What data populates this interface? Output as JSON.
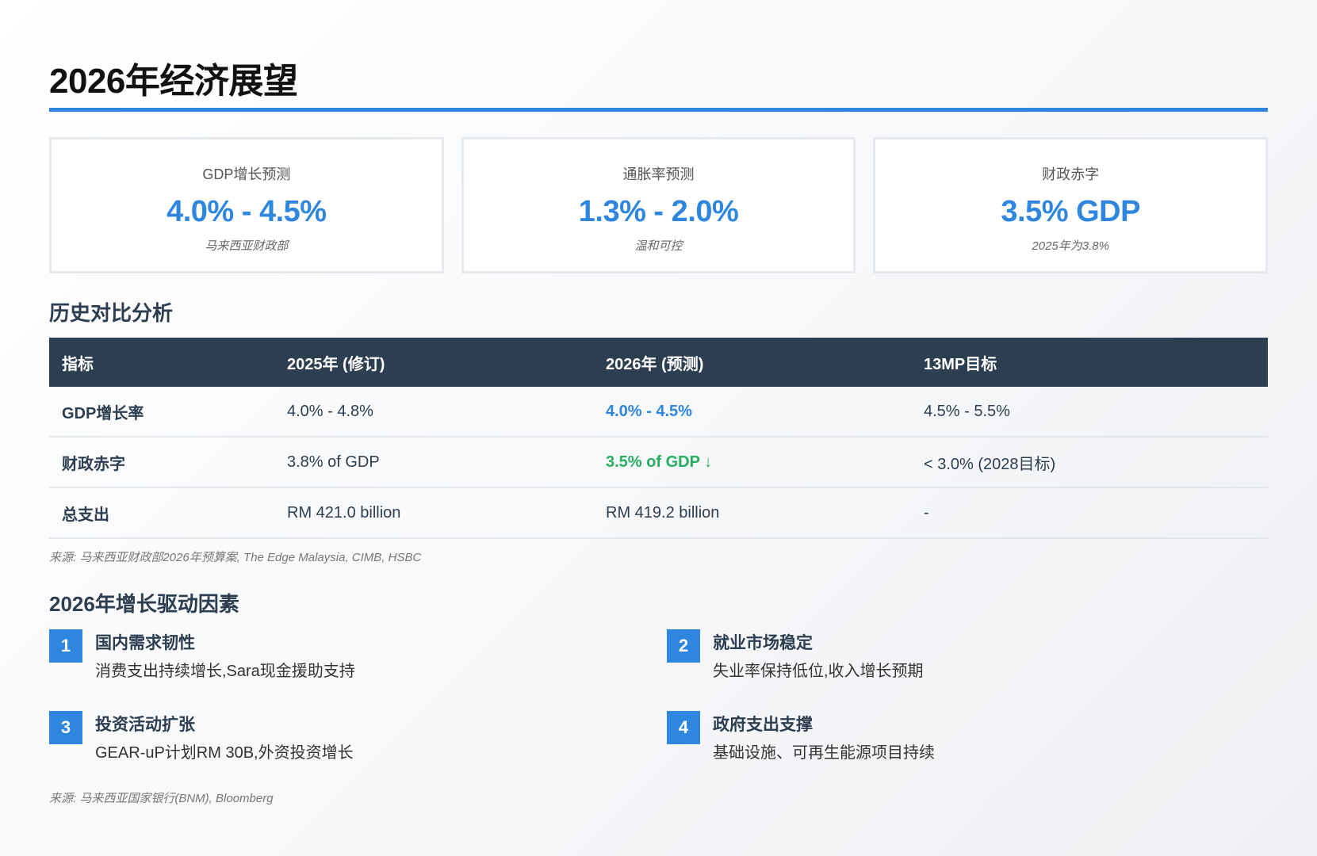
{
  "title": "2026年经济展望",
  "colors": {
    "accent": "#2e86de",
    "header_bg": "#2c3e50",
    "positive": "#27ae60"
  },
  "cards": [
    {
      "label": "GDP增长预测",
      "value": "4.0% - 4.5%",
      "note": "马来西亚财政部"
    },
    {
      "label": "通胀率预测",
      "value": "1.3% - 2.0%",
      "note": "温和可控"
    },
    {
      "label": "财政赤字",
      "value": "3.5% GDP",
      "note": "2025年为3.8%"
    }
  ],
  "history": {
    "heading": "历史对比分析",
    "columns": [
      "指标",
      "2025年 (修订)",
      "2026年 (预测)",
      "13MP目标"
    ],
    "rows": [
      [
        "GDP增长率",
        "4.0% - 4.8%",
        "4.0% - 4.5%",
        "4.5% - 5.5%"
      ],
      [
        "财政赤字",
        "3.8% of GDP",
        "3.5% of GDP ↓",
        "< 3.0% (2028目标)"
      ],
      [
        "总支出",
        "RM 421.0 billion",
        "RM 419.2 billion",
        "-"
      ]
    ],
    "source": "来源: 马来西亚财政部2026年预算案, The Edge Malaysia, CIMB, HSBC"
  },
  "drivers": {
    "heading": "2026年增长驱动因素",
    "items": [
      {
        "num": "1",
        "title": "国内需求韧性",
        "desc": "消费支出持续增长,Sara现金援助支持"
      },
      {
        "num": "2",
        "title": "就业市场稳定",
        "desc": "失业率保持低位,收入增长预期"
      },
      {
        "num": "3",
        "title": "投资活动扩张",
        "desc": "GEAR-uP计划RM 30B,外资投资增长"
      },
      {
        "num": "4",
        "title": "政府支出支撑",
        "desc": "基础设施、可再生能源项目持续"
      }
    ],
    "source": "来源: 马来西亚国家银行(BNM), Bloomberg"
  }
}
